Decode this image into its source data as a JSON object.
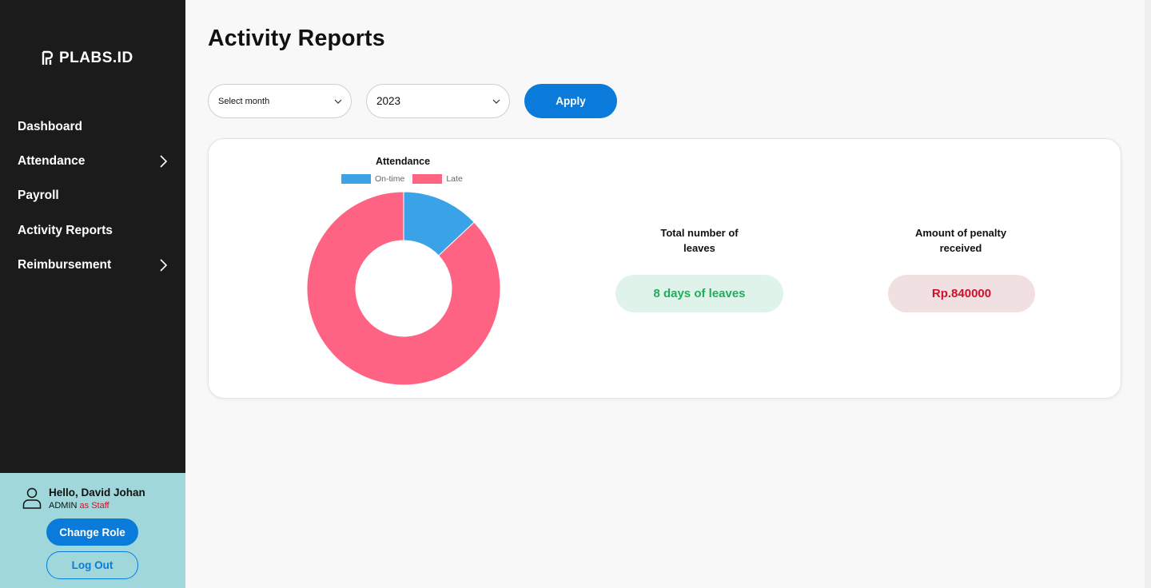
{
  "brand": {
    "name": "PLABS.ID"
  },
  "sidebar": {
    "items": [
      {
        "label": "Dashboard",
        "has_chevron": false
      },
      {
        "label": "Attendance",
        "has_chevron": true
      },
      {
        "label": "Payroll",
        "has_chevron": false
      },
      {
        "label": "Activity Reports",
        "has_chevron": false
      },
      {
        "label": "Reimbursement",
        "has_chevron": true
      }
    ]
  },
  "user": {
    "greeting": "Hello, David Johan",
    "role": "ADMIN",
    "as_label": "as Staff",
    "change_role_label": "Change Role",
    "logout_label": "Log Out"
  },
  "page": {
    "title": "Activity Reports"
  },
  "filters": {
    "month": {
      "value": "Select month"
    },
    "year": {
      "value": "2023"
    },
    "apply_label": "Apply"
  },
  "stats": {
    "leaves_label": "Total number of leaves",
    "leaves_value": "8 days of leaves",
    "penalty_label": "Amount of penalty received",
    "penalty_value": "Rp.840000"
  },
  "colors": {
    "sidebar_bg": "#1b1b1b",
    "accent": "#0a7bdb",
    "ontime": "#3aa3e8",
    "late": "#ff6384",
    "success": "#22ad5c",
    "danger": "#d0102b"
  },
  "chart_data": {
    "type": "pie",
    "title": "Attendance",
    "donut": true,
    "categories": [
      "On-time",
      "Late"
    ],
    "values": [
      13,
      87
    ],
    "colors": [
      "#3aa3e8",
      "#ff6384"
    ],
    "legend": "top"
  }
}
